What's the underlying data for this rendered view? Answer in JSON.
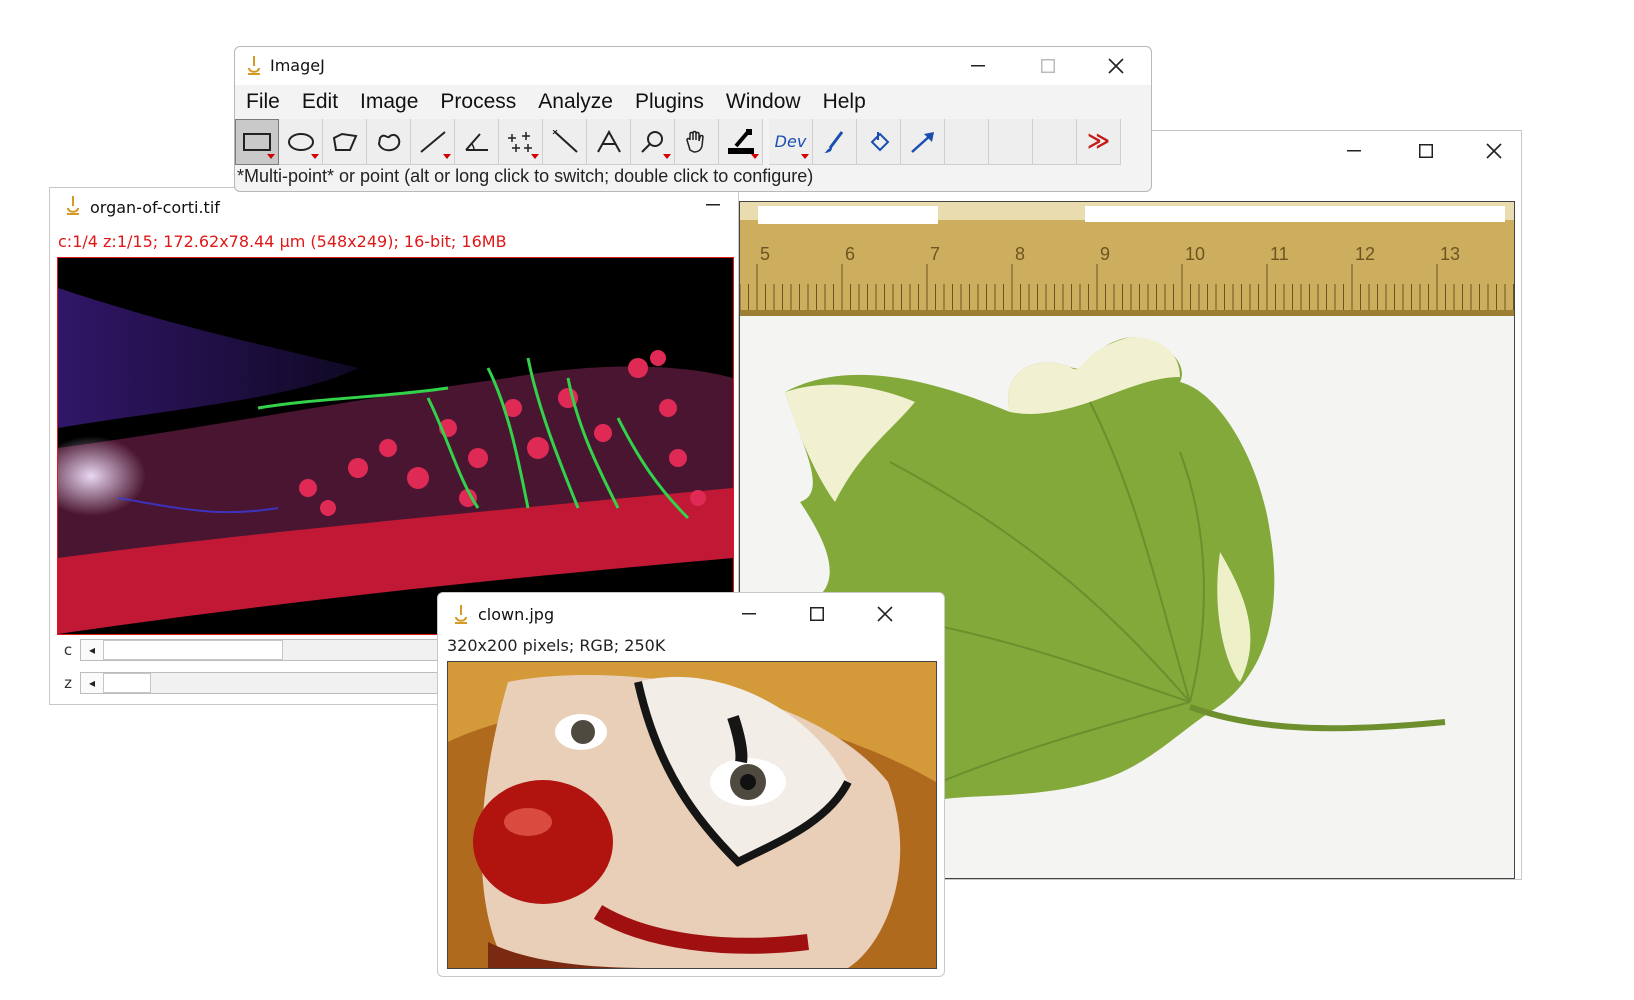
{
  "imagej": {
    "title": "ImageJ",
    "menu": [
      "File",
      "Edit",
      "Image",
      "Process",
      "Analyze",
      "Plugins",
      "Window",
      "Help"
    ],
    "tools": [
      {
        "name": "rectangle-tool-icon",
        "selected": true,
        "has_menu": true
      },
      {
        "name": "oval-tool-icon",
        "selected": false,
        "has_menu": true
      },
      {
        "name": "polygon-tool-icon",
        "selected": false,
        "has_menu": false
      },
      {
        "name": "freehand-tool-icon",
        "selected": false,
        "has_menu": false
      },
      {
        "name": "line-tool-icon",
        "selected": false,
        "has_menu": true
      },
      {
        "name": "angle-tool-icon",
        "selected": false,
        "has_menu": false
      },
      {
        "name": "multi-point-tool-icon",
        "selected": false,
        "has_menu": true
      },
      {
        "name": "wand-tool-icon",
        "selected": false,
        "has_menu": false
      },
      {
        "name": "text-tool-icon",
        "selected": false,
        "has_menu": false
      },
      {
        "name": "magnifier-tool-icon",
        "selected": false,
        "has_menu": true
      },
      {
        "name": "hand-tool-icon",
        "selected": false,
        "has_menu": false
      },
      {
        "name": "color-picker-tool-icon",
        "selected": false,
        "has_menu": true
      },
      {
        "name": "dev-tool-icon",
        "selected": false,
        "has_menu": true,
        "label": "Dev"
      },
      {
        "name": "brush-tool-icon",
        "selected": false,
        "has_menu": false
      },
      {
        "name": "flood-fill-tool-icon",
        "selected": false,
        "has_menu": false
      },
      {
        "name": "arrow-tool-icon",
        "selected": false,
        "has_menu": false
      },
      {
        "name": "empty-tool-slot",
        "selected": false,
        "has_menu": false
      },
      {
        "name": "empty-tool-slot",
        "selected": false,
        "has_menu": false
      },
      {
        "name": "empty-tool-slot",
        "selected": false,
        "has_menu": false
      },
      {
        "name": "more-tools-icon",
        "selected": false,
        "has_menu": false,
        "label": "≫"
      }
    ],
    "status": "*Multi-point* or point (alt or long click to switch; double click to configure)"
  },
  "organ": {
    "title": "organ-of-corti.tif",
    "info": "c:1/4 z:1/15; 172.62x78.44 µm (548x249); 16-bit; 16MB",
    "sliders": [
      {
        "label": "c",
        "position": 0.37
      },
      {
        "label": "z",
        "position": 0.07
      }
    ]
  },
  "clown": {
    "title": "clown.jpg",
    "info": "320x200 pixels; RGB; 250K"
  },
  "leaf": {
    "title": "",
    "ruler_ticks": [
      "5",
      "6",
      "7",
      "8",
      "9",
      "10",
      "11",
      "12",
      "13"
    ]
  },
  "colors": {
    "accent_red": "#e01818",
    "leaf_green": "#7aa33a",
    "ruler_tan": "#c9aa55"
  }
}
